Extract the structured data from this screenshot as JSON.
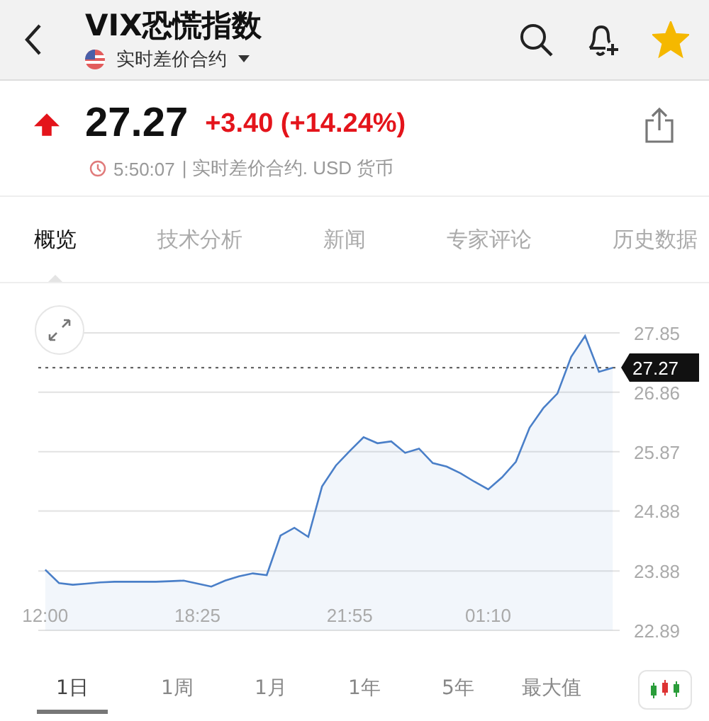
{
  "header": {
    "title": "VIX恐慌指数",
    "subtitle": "实时差价合约",
    "favorited": true
  },
  "quote": {
    "rising": true,
    "price": "27.27",
    "change": "+3.40 (+14.24%)",
    "time": "5:50:07",
    "info": "| 实时差价合约. USD 货币"
  },
  "tabs": [
    {
      "label": "概览",
      "selected": true
    },
    {
      "label": "技术分析",
      "selected": false
    },
    {
      "label": "新闻",
      "selected": false
    },
    {
      "label": "专家评论",
      "selected": false
    },
    {
      "label": "历史数据",
      "selected": false
    }
  ],
  "chart": {
    "chart_data": {
      "type": "area",
      "grid": true,
      "ref_lines": [
        {
          "axis": "y",
          "value": 27.27,
          "label": "27.27"
        }
      ],
      "categories": [
        "12:00",
        null,
        null,
        null,
        null,
        null,
        null,
        null,
        null,
        null,
        null,
        "18:25",
        null,
        null,
        null,
        null,
        null,
        null,
        null,
        null,
        null,
        null,
        "21:55",
        null,
        null,
        null,
        null,
        null,
        null,
        null,
        null,
        null,
        "01:10",
        null,
        null,
        null,
        null,
        null,
        null,
        null,
        null,
        null
      ],
      "series": [
        {
          "color": "#4a7fc8",
          "values": [
            23.9,
            23.68,
            23.65,
            23.67,
            23.69,
            23.7,
            23.7,
            23.7,
            23.7,
            23.71,
            23.72,
            23.67,
            23.62,
            23.72,
            23.79,
            23.84,
            23.81,
            24.47,
            24.6,
            24.45,
            25.29,
            25.64,
            25.88,
            26.11,
            26.01,
            26.04,
            25.85,
            25.92,
            25.68,
            25.62,
            25.51,
            25.37,
            25.24,
            25.44,
            25.7,
            26.27,
            26.6,
            26.84,
            27.45,
            27.8,
            27.2,
            27.27
          ]
        }
      ],
      "ylim": [
        22.89,
        27.85
      ],
      "yticks": [
        27.85,
        26.86,
        25.87,
        24.88,
        23.88,
        22.89
      ]
    }
  },
  "ranges": [
    {
      "label": "1日",
      "selected": true
    },
    {
      "label": "1周",
      "selected": false
    },
    {
      "label": "1月",
      "selected": false
    },
    {
      "label": "1年",
      "selected": false
    },
    {
      "label": "5年",
      "selected": false
    },
    {
      "label": "最大值",
      "selected": false
    }
  ]
}
